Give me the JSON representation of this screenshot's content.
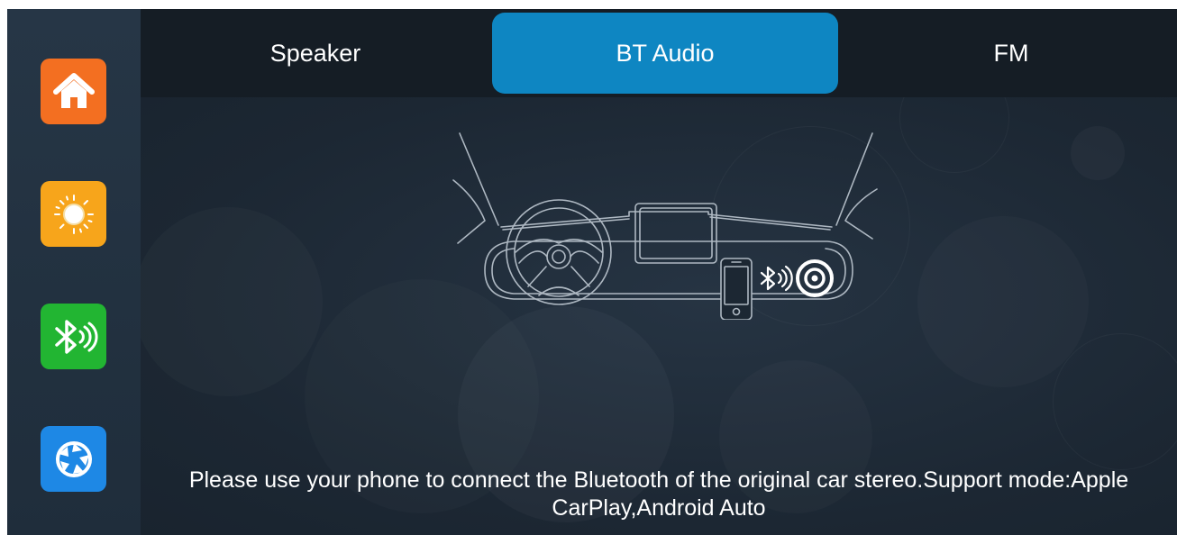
{
  "sidebar": {
    "items": [
      {
        "icon": "home-icon",
        "color": "#f36f21"
      },
      {
        "icon": "brightness-icon",
        "color": "#f7a51b"
      },
      {
        "icon": "bluetooth-audio-icon",
        "color": "#22b532"
      },
      {
        "icon": "aperture-icon",
        "color": "#1e88e5"
      }
    ]
  },
  "tabs": [
    {
      "label": "Speaker",
      "active": false
    },
    {
      "label": "BT Audio",
      "active": true
    },
    {
      "label": "FM",
      "active": false
    }
  ],
  "colors": {
    "active_tab": "#0e86c2",
    "background": "#1c2733",
    "topbar": "#151d25",
    "sidebar": "#243444"
  },
  "main": {
    "illustration": "car-dashboard-bluetooth-illustration",
    "message": "Please use your phone to connect the Bluetooth of the original car stereo.Support mode:Apple CarPlay,Android Auto"
  }
}
